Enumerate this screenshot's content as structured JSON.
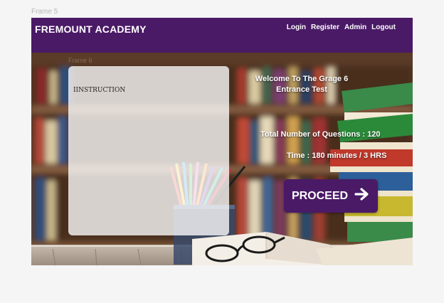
{
  "frame_label": "Frame 5",
  "sub_frame_label": "Frame 6",
  "header": {
    "brand": "FREMOUNT ACADEMY",
    "nav": [
      "Login",
      "Register",
      "Admin",
      "Logout"
    ]
  },
  "instruction_panel": {
    "heading": "IINSTRUCTION"
  },
  "test_info": {
    "welcome_line1": "Welcome To The  Grage 6",
    "welcome_line2": "Entrance  Test",
    "questions": "Total Number of Questions : 120",
    "time": "Time : 180 minutes / 3 HRS"
  },
  "proceed_button": {
    "label": "PROCEED",
    "icon": "arrow-right-icon"
  },
  "colors": {
    "brand_purple": "#4a1a66",
    "page_background": "#f5f5f5"
  }
}
